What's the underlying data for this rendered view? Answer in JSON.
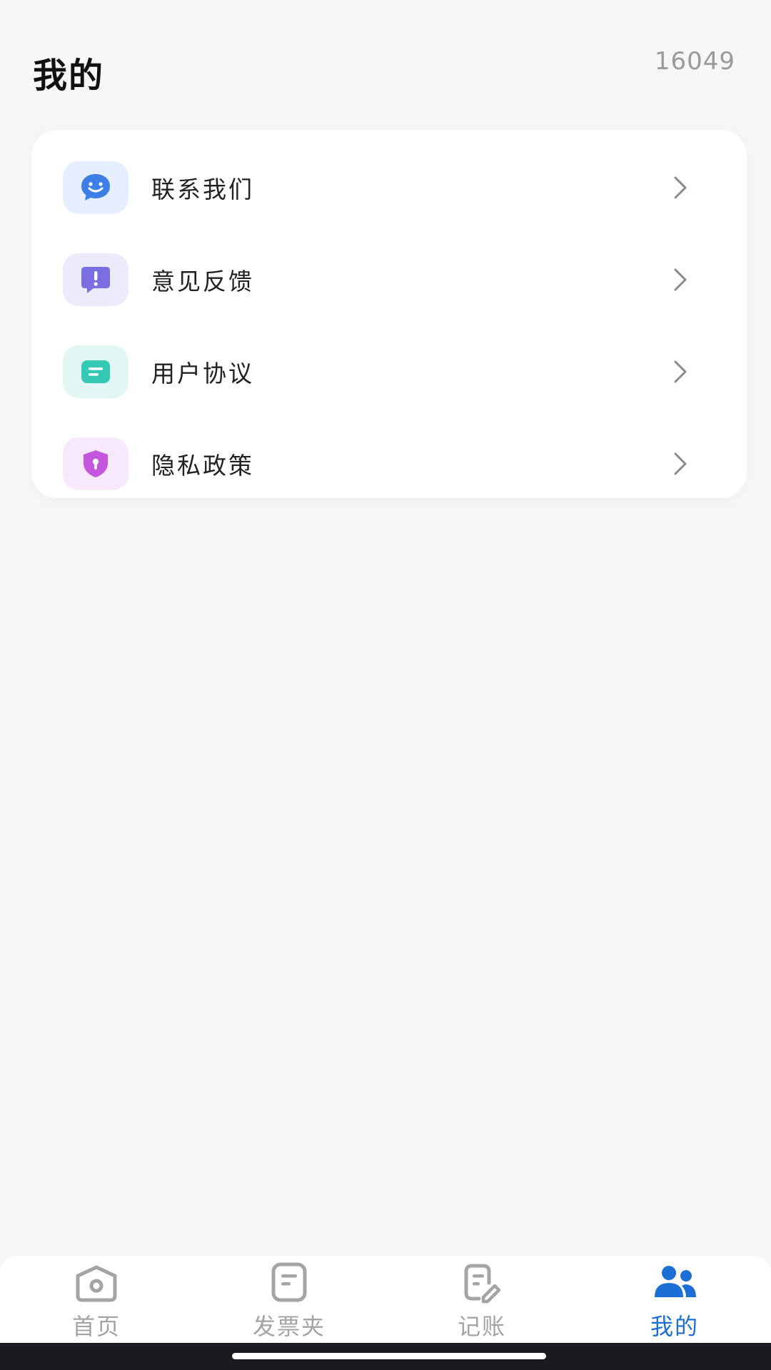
{
  "header": {
    "title": "我的",
    "code": "16049"
  },
  "menu": {
    "items": [
      {
        "label": "联系我们",
        "icon": "chat-smile-icon",
        "icon_color": "#3d7fe6",
        "icon_bg": "#e6efff"
      },
      {
        "label": "意见反馈",
        "icon": "feedback-alert-icon",
        "icon_color": "#7a6fe0",
        "icon_bg": "#ecebfb"
      },
      {
        "label": "用户协议",
        "icon": "document-icon",
        "icon_color": "#33c9b3",
        "icon_bg": "#e2f7f3"
      },
      {
        "label": "隐私政策",
        "icon": "shield-lock-icon",
        "icon_color": "#c455dd",
        "icon_bg": "#f8e8fb"
      }
    ]
  },
  "bottom_nav": {
    "items": [
      {
        "label": "首页",
        "icon": "camera-home-icon",
        "active": false
      },
      {
        "label": "发票夹",
        "icon": "invoice-folder-icon",
        "active": false
      },
      {
        "label": "记账",
        "icon": "ledger-edit-icon",
        "active": false
      },
      {
        "label": "我的",
        "icon": "users-icon",
        "active": true
      }
    ],
    "active_color": "#1c6fd4",
    "inactive_color": "#a4a4a4"
  }
}
